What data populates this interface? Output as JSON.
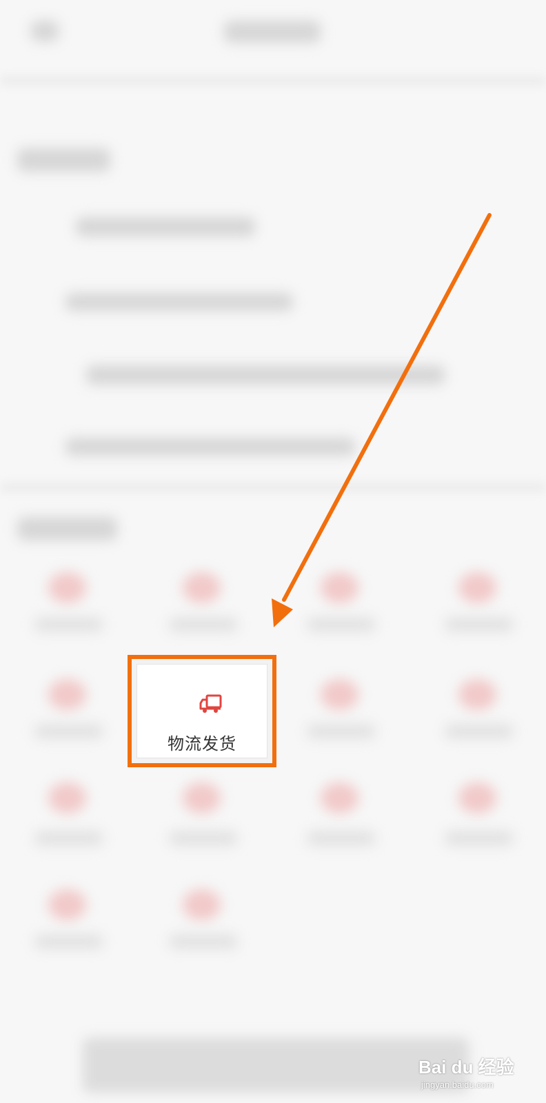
{
  "highlighted_item": {
    "icon": "truck-icon",
    "label": "物流发货",
    "icon_color": "#e0453f"
  },
  "annotation": {
    "color": "#f26f0d"
  },
  "watermark": {
    "logo": "Bai du 经验",
    "url": "jingyan.baidu.com"
  }
}
